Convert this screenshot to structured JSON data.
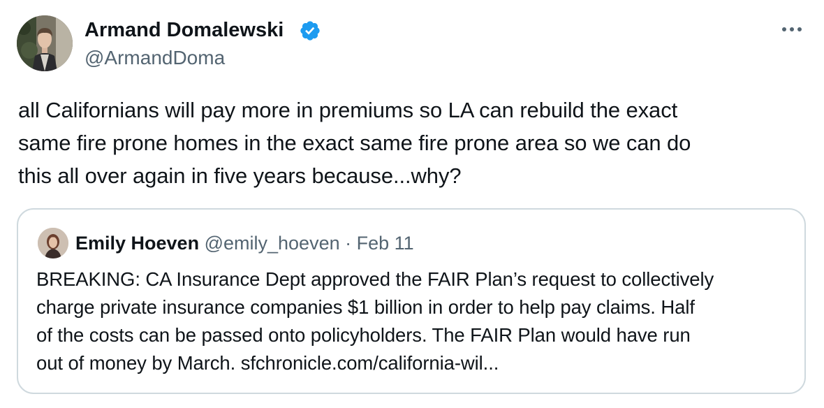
{
  "author": {
    "name": "Armand Domalewski",
    "handle": "@ArmandDoma",
    "verified_color": "#1d9bf0"
  },
  "more_icon": "more-horizontal-icon",
  "tweet": {
    "lines": [
      "all Californians will pay more in premiums so LA can rebuild the exact",
      "same fire prone homes in the exact same fire prone area so we can do",
      "this all over again in five years because...why?"
    ]
  },
  "quote": {
    "name": "Emily Hoeven",
    "handle": "@emily_hoeven",
    "separator": "·",
    "date": "Feb 11",
    "lines": [
      "BREAKING: CA Insurance Dept approved the FAIR Plan’s request to collectively",
      "charge private insurance companies $1 billion in order to help pay claims. Half",
      "of the costs can be passed onto policyholders. The FAIR Plan would have run",
      "out of money by March. sfchronicle.com/california-wil..."
    ]
  },
  "colors": {
    "text": "#0f1419",
    "secondary": "#536471",
    "border": "#cfd9de"
  }
}
